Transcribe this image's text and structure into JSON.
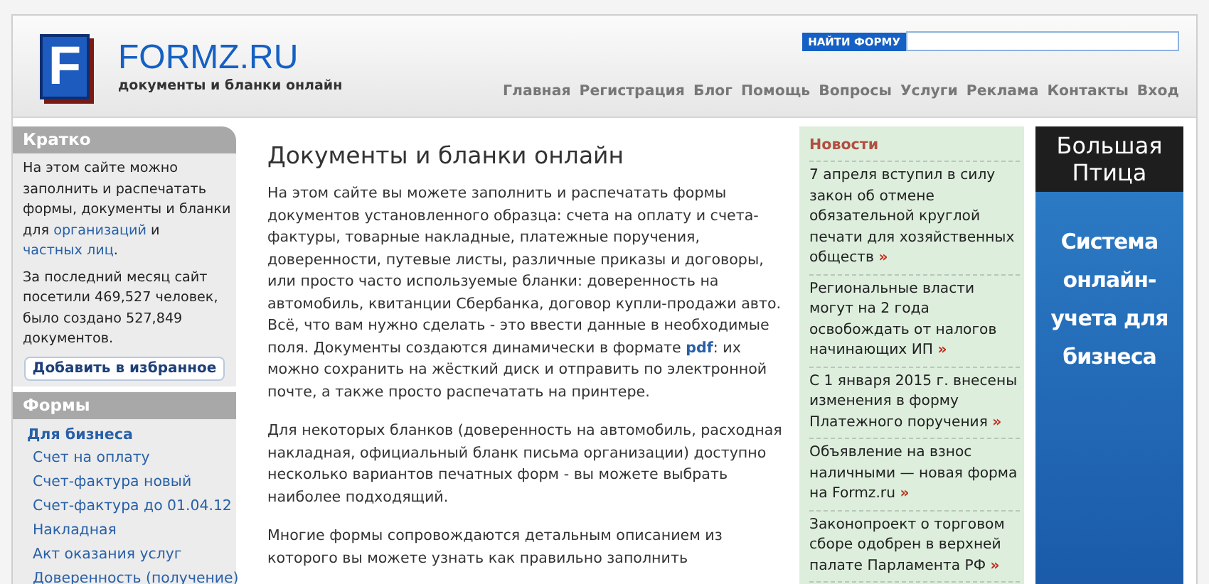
{
  "header": {
    "logo_letter": "F",
    "site_name": "FORMZ.RU",
    "tagline": "документы и бланки онлайн",
    "search": {
      "label": "НАЙТИ ФОРМУ"
    },
    "nav": [
      "Главная",
      "Регистрация",
      "Блог",
      "Помощь",
      "Вопросы",
      "Услуги",
      "Реклама",
      "Контакты",
      "Вход"
    ]
  },
  "sidebar": {
    "brief": {
      "title": "Кратко",
      "paragraphs": [
        [
          {
            "kind": "text",
            "text": "На этом сайте можно заполнить и распечатать формы, документы и бланки для "
          },
          {
            "kind": "link",
            "text": "организаций"
          },
          {
            "kind": "text",
            "text": " и "
          },
          {
            "kind": "link",
            "text": "частных лиц"
          },
          {
            "kind": "text",
            "text": "."
          }
        ],
        [
          {
            "kind": "text",
            "text": "За последний месяц сайт посетили 469,527 человек, было создано 527,849 документов."
          }
        ]
      ],
      "button": "Добавить в избранное"
    },
    "forms": {
      "title": "Формы",
      "group": "Для бизнеса",
      "items": [
        "Счет на оплату",
        "Счет-фактура новый",
        "Счет-фактура до 01.04.12",
        "Накладная",
        "Акт оказания услуг",
        "Доверенность (получение)"
      ]
    }
  },
  "main": {
    "title": "Документы и бланки онлайн",
    "paragraphs": [
      [
        {
          "kind": "text",
          "text": "На этом сайте вы можете заполнить и распечатать формы документов установленного образца: счета на оплату и счета-фактуры, товарные накладные, платежные поручения, доверенности, путевые листы, различные приказы и договоры, или просто часто используемые бланки: доверенность на автомобиль, квитанции Сбербанка, договор купли-продажи авто. Всё, что вам нужно сделать - это ввести данные в необходимые поля. Документы создаются динамически в формате "
        },
        {
          "kind": "link",
          "text": "pdf"
        },
        {
          "kind": "text",
          "text": ": их можно сохранить на жёсткий диск и отправить по электронной почте, а также просто распечатать на принтере."
        }
      ],
      [
        {
          "kind": "text",
          "text": "Для некоторых бланков (доверенность на автомобиль, расходная накладная, официальный бланк письма организации) доступно несколько вариантов печатных форм - вы можете выбрать наиболее подходящий."
        }
      ],
      [
        {
          "kind": "text",
          "text": "Многие формы сопровождаются детальным описанием из которого вы можете узнать как правильно заполнить"
        }
      ]
    ]
  },
  "news": {
    "title": "Новости",
    "items": [
      {
        "text": "7 апреля вступил в силу закон об отмене обязательной круглой печати для хозяйственных обществ",
        "more": "»"
      },
      {
        "text": "Региональные власти могут на 2 года освобождать от налогов начинающих ИП",
        "more": "»"
      },
      {
        "text": "С 1 января 2015 г. внесены изменения в форму Платежного поручения",
        "more": "»"
      },
      {
        "text": "Объявление на взнос наличными — новая форма на Formz.ru",
        "more": "»"
      },
      {
        "text": "Законопроект о торговом сборе одобрен в верхней палате Парламента РФ",
        "more": "»"
      }
    ]
  },
  "ad": {
    "brand": "Большая Птица",
    "slogan": "Система онлайн-учета для бизнеса"
  }
}
